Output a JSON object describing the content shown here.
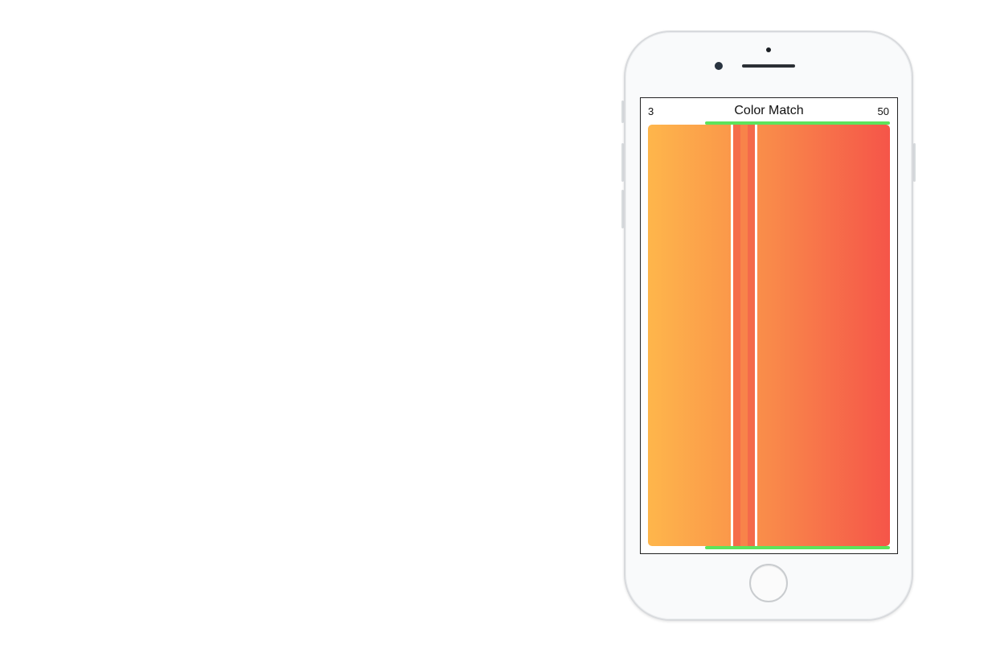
{
  "app": {
    "title": "Color Match",
    "level": "3",
    "score": "50"
  },
  "colors": {
    "gradient_start": "#feb64b",
    "gradient_mid": "#f98a4a",
    "gradient_end": "#f55549",
    "progress": "#5de35b",
    "marker": "#ffffff",
    "stripe_a": "#f56c4a",
    "stripe_b": "#f8834a",
    "stripe_c": "#f46a4a"
  },
  "icons": {
    "home": "home-button-icon",
    "camera": "front-camera-icon",
    "speaker": "earpiece-speaker-icon"
  }
}
